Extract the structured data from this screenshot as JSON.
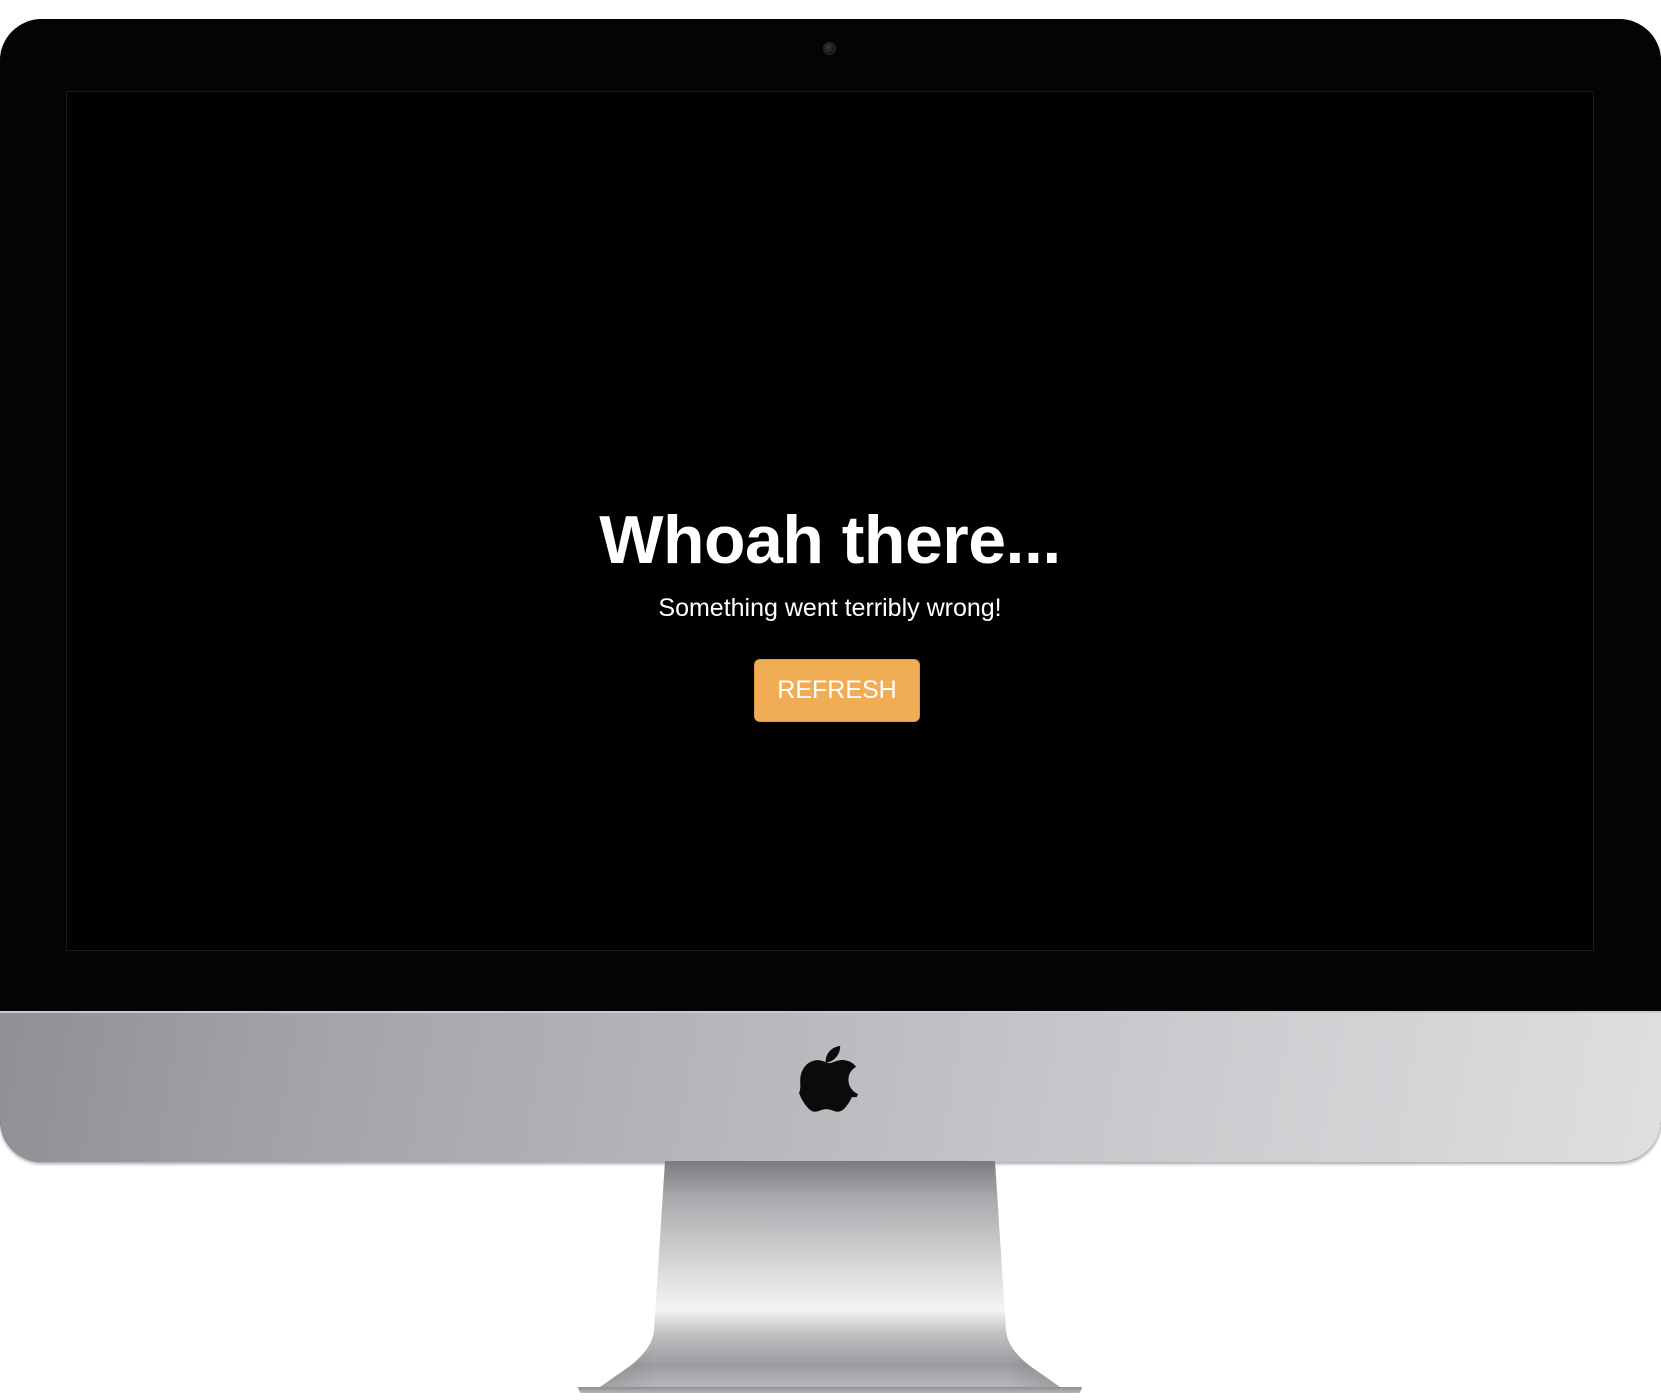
{
  "error_page": {
    "title": "Whoah there...",
    "message": "Something went terribly wrong!",
    "refresh_label": "REFRESH"
  },
  "colors": {
    "screen_background": "#000000",
    "text": "#ffffff",
    "button_background": "#f0ad55"
  },
  "icons": {
    "brand_logo": "apple-logo",
    "camera": "camera-icon"
  }
}
